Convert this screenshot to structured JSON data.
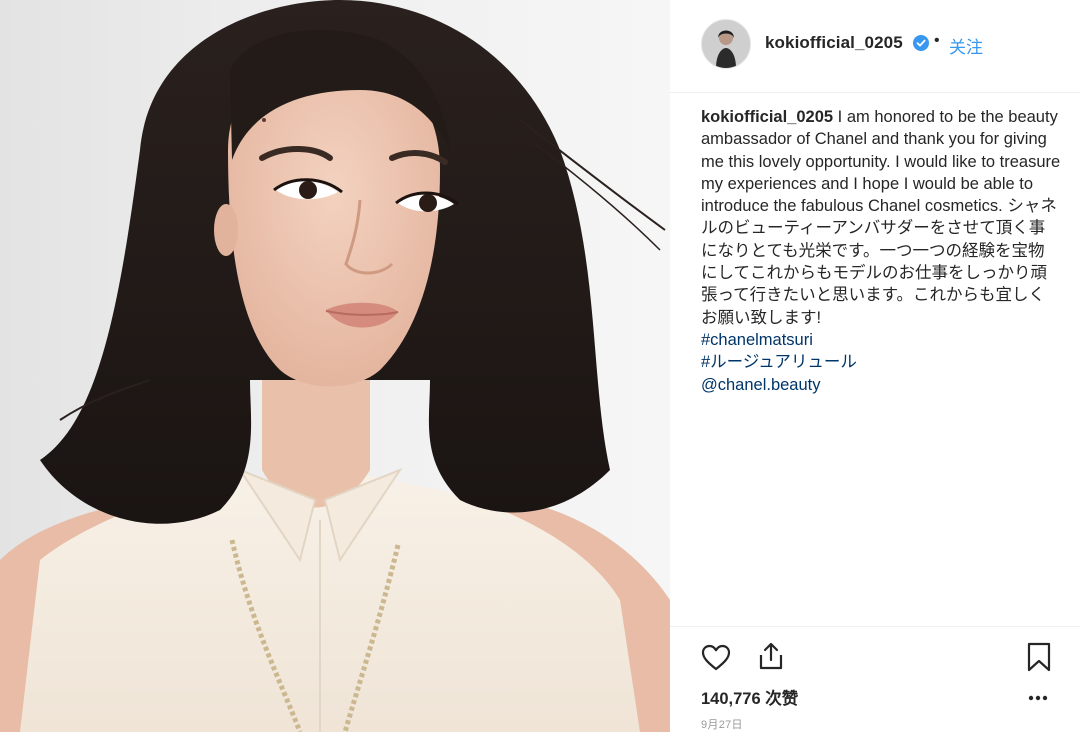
{
  "post": {
    "image_alt": "Portrait photo",
    "header": {
      "username": "kokiofficial_0205",
      "separator": "•",
      "follow_label": "关注",
      "avatar_icon": "profile-avatar"
    },
    "caption": {
      "username": "kokiofficial_0205",
      "text": " I am honored to be the beauty ambassador of Chanel and thank you for giving me this lovely opportunity. I would like to treasure my experiences and I hope I would be able to introduce the fabulous Chanel cosmetics. シャネルのビューティーアンバサダーをさせて頂く事になりとても光栄です。一つ一つの経験を宝物にしてこれからもモデルのお仕事をしっかり頑張って行きたいと思います。これからも宜しくお願い致します!",
      "hashtags": [
        "#chanelmatsuri",
        "#ルージュアリュール",
        "@chanel.beauty"
      ]
    },
    "actions": {
      "like_icon": "heart-icon",
      "share_icon": "share-icon",
      "save_icon": "bookmark-icon",
      "more_icon": "more-icon"
    },
    "likes": "140,776 次赞",
    "date": "9月27日",
    "colors": {
      "link": "#3897f0",
      "hashtag": "#003569",
      "verified": "#3897f0",
      "text": "#262626",
      "muted": "#999999"
    }
  }
}
